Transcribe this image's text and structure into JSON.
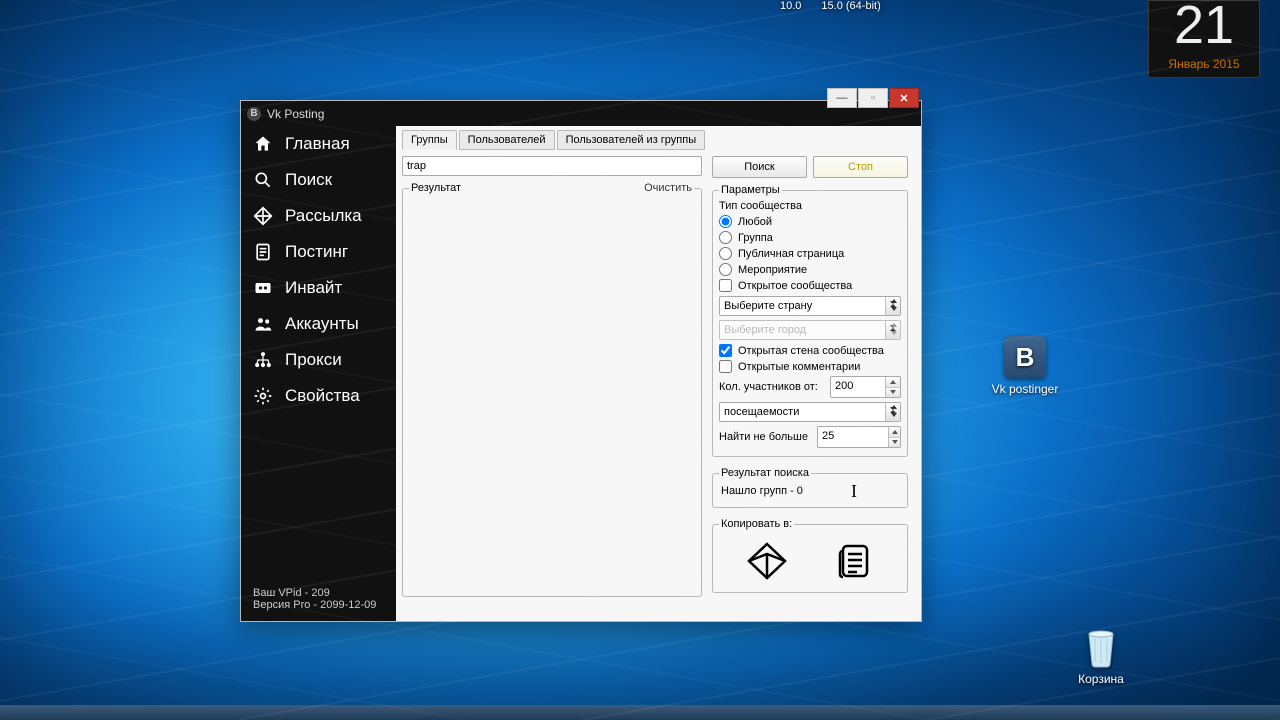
{
  "toptext": {
    "v1": "10.0",
    "v2": "15.0 (64-bit)"
  },
  "clock": {
    "day": "21",
    "month": "Январь 2015"
  },
  "desktop": {
    "vk": "Vk postinger",
    "bin": "Корзина"
  },
  "app": {
    "title": "Vk Posting",
    "sidebar": {
      "items": [
        {
          "label": "Главная"
        },
        {
          "label": "Поиск"
        },
        {
          "label": "Рассылка"
        },
        {
          "label": "Постинг"
        },
        {
          "label": "Инвайт"
        },
        {
          "label": "Аккаунты"
        },
        {
          "label": "Прокси"
        },
        {
          "label": "Свойства"
        }
      ],
      "footer1": "Ваш VPid - 209",
      "footer2": "Версия Pro - 2099-12-09"
    },
    "tabs": [
      "Группы",
      "Пользователей",
      "Пользователей из группы"
    ],
    "query": "trap",
    "btn_search": "Поиск",
    "btn_stop": "Стоп",
    "result_legend": "Результат",
    "clear": "Очистить",
    "params_legend": "Параметры",
    "type_label": "Тип сообщества",
    "type_options": [
      "Любой",
      "Группа",
      "Публичная страница",
      "Мероприятие"
    ],
    "open_comm": "Открытое  сообщества",
    "country_ph": "Выберите страну",
    "city_ph": "Выберите город",
    "open_wall": "Открытая стена сообщества",
    "open_comments": "Открытые комментарии",
    "members_from": "Кол. участников от:",
    "members_val": "200",
    "sort_val": "посещаемости",
    "find_max": "Найти не больше",
    "find_val": "25",
    "result2_legend": "Результат поиска",
    "found": "Нашло групп  -  0",
    "copy_legend": "Копировать в:"
  }
}
